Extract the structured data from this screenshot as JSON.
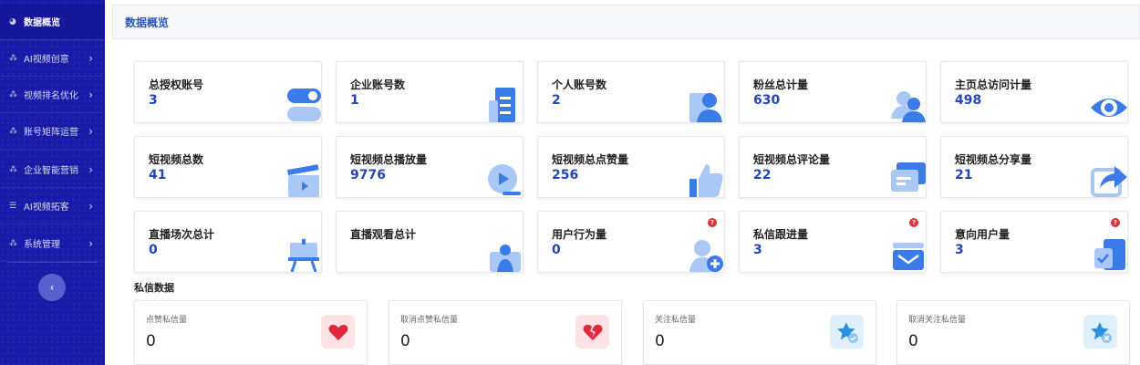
{
  "sidebar": {
    "items": [
      {
        "label": "数据概览",
        "icon": "dashboard-icon"
      },
      {
        "label": "AI视频创意",
        "icon": "network-icon"
      },
      {
        "label": "视频排名优化",
        "icon": "network-icon"
      },
      {
        "label": "账号矩阵运营",
        "icon": "network-icon"
      },
      {
        "label": "企业智能营销",
        "icon": "network-icon"
      },
      {
        "label": "AI视频拓客",
        "icon": "list-icon"
      },
      {
        "label": "系统管理",
        "icon": "network-icon"
      }
    ],
    "collapse_icon": "‹"
  },
  "page": {
    "title": "数据概览"
  },
  "stats": [
    {
      "label": "总授权账号",
      "value": "3",
      "icon": "toggle-icon"
    },
    {
      "label": "企业账号数",
      "value": "1",
      "icon": "building-icon"
    },
    {
      "label": "个人账号数",
      "value": "2",
      "icon": "user-icon"
    },
    {
      "label": "粉丝总计量",
      "value": "630",
      "icon": "fans-icon"
    },
    {
      "label": "主页总访问计量",
      "value": "498",
      "icon": "eye-icon"
    },
    {
      "label": "短视频总数",
      "value": "41",
      "icon": "clapper-icon"
    },
    {
      "label": "短视频总播放量",
      "value": "9776",
      "icon": "play-icon"
    },
    {
      "label": "短视频总点赞量",
      "value": "256",
      "icon": "thumbs-up-icon"
    },
    {
      "label": "短视频总评论量",
      "value": "22",
      "icon": "comment-icon"
    },
    {
      "label": "短视频总分享量",
      "value": "21",
      "icon": "share-icon"
    },
    {
      "label": "直播场次总计",
      "value": "0",
      "icon": "easel-icon"
    },
    {
      "label": "直播观看总计",
      "value": "",
      "icon": "viewer-icon"
    },
    {
      "label": "用户行为量",
      "value": "0",
      "icon": "user-add-icon",
      "help": "?"
    },
    {
      "label": "私信跟进量",
      "value": "3",
      "icon": "message-icon",
      "help": "?"
    },
    {
      "label": "意向用户量",
      "value": "3",
      "icon": "intent-icon",
      "help": "?"
    }
  ],
  "private_section": {
    "title": "私信数据",
    "cards": [
      {
        "label": "点赞私信量",
        "value": "0",
        "icon": "heart-icon",
        "bg": "#fde3e6",
        "fg": "#e0283c"
      },
      {
        "label": "取消点赞私信量",
        "value": "0",
        "icon": "broken-heart-icon",
        "bg": "#fde3e6",
        "fg": "#e0283c"
      },
      {
        "label": "关注私信量",
        "value": "0",
        "icon": "star-check-icon",
        "bg": "#dff0fb",
        "fg": "#2e8fe0"
      },
      {
        "label": "取消关注私信量",
        "value": "0",
        "icon": "star-remove-icon",
        "bg": "#dff0fb",
        "fg": "#2e8fe0"
      }
    ]
  },
  "colors": {
    "sidebar": "#1a1aa8",
    "accent": "#2b57c8",
    "icon_blue": "#3a7be8",
    "icon_light": "#a9c8f5"
  }
}
